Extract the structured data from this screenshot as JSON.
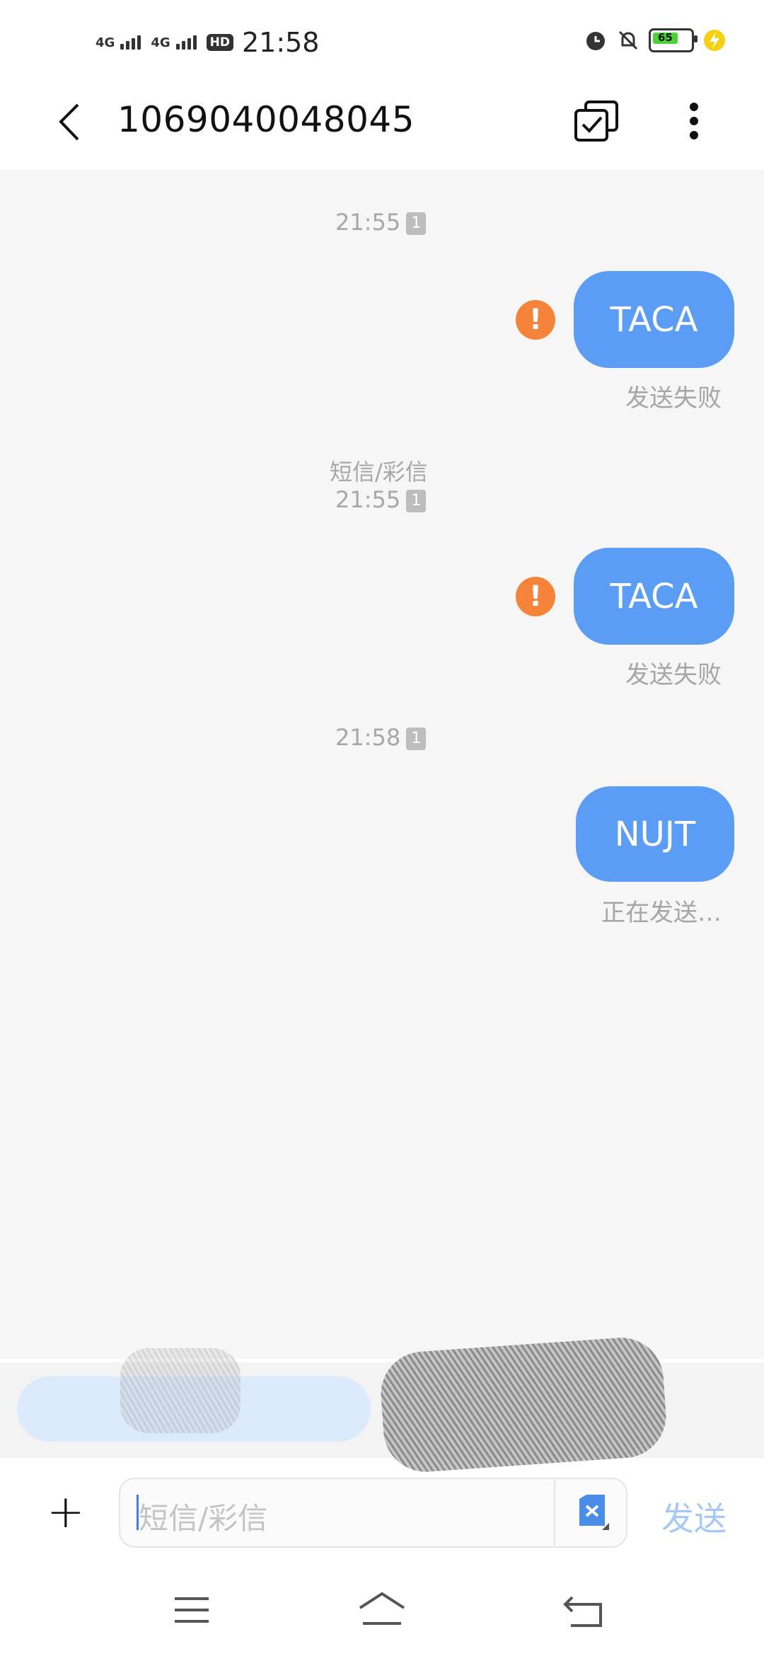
{
  "status_bar": {
    "network1": "4G",
    "network2": "4G",
    "hd_badge": "HD",
    "time": "21:58",
    "battery_level": "65"
  },
  "header": {
    "title": "1069040048045"
  },
  "messages": [
    {
      "timestamp": "21:55",
      "sim": "1",
      "text": "TACA",
      "status": "发送失败",
      "failed": true
    },
    {
      "type_label": "短信/彩信",
      "timestamp": "21:55",
      "sim": "1",
      "text": "TACA",
      "status": "发送失败",
      "failed": true
    },
    {
      "timestamp": "21:58",
      "sim": "1",
      "text": "NUJT",
      "status": "正在发送…",
      "failed": false
    }
  ],
  "composer": {
    "placeholder": "短信/彩信",
    "send_label": "发送"
  },
  "colors": {
    "bubble": "#5b9df5",
    "error": "#f5843a",
    "send_disabled": "#a8c9f5"
  }
}
